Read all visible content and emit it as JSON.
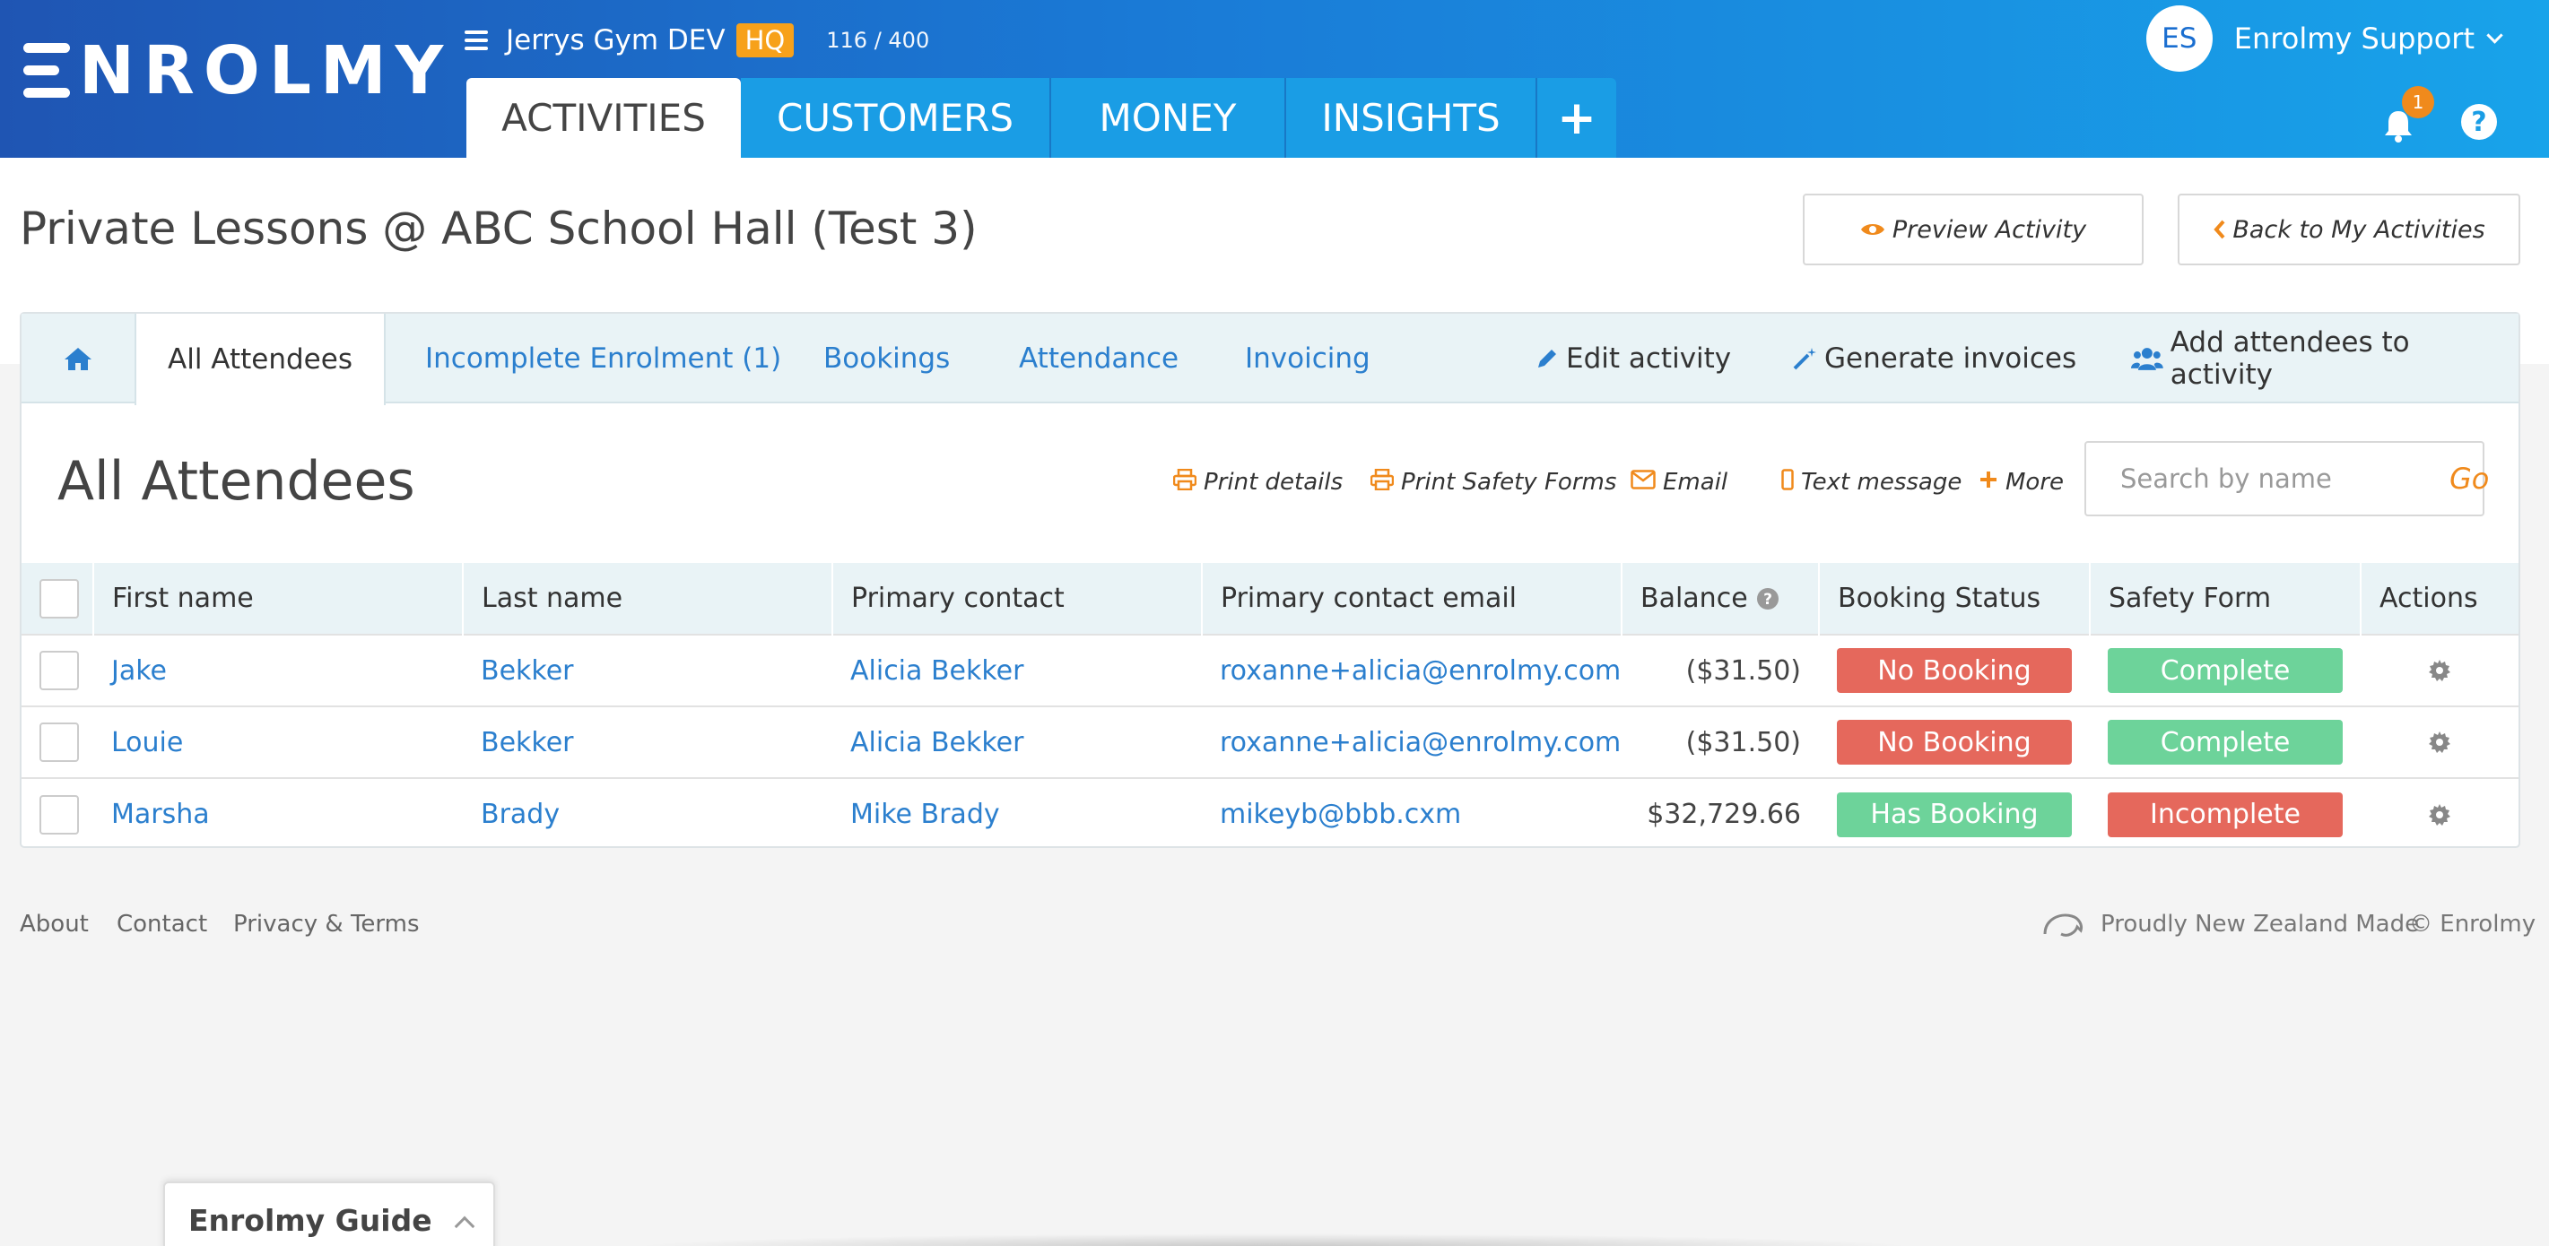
{
  "app": {
    "logo": "ENROLMY",
    "org_name": "Jerrys Gym DEV",
    "org_badge": "HQ",
    "usage": "116 / 400",
    "user_initials": "ES",
    "user_name": "Enrolmy Support",
    "notifications_count": "1",
    "help": "?"
  },
  "nav": {
    "tabs": [
      "ACTIVITIES",
      "CUSTOMERS",
      "MONEY",
      "INSIGHTS"
    ],
    "plus": "+",
    "active": "ACTIVITIES"
  },
  "page": {
    "title": "Private Lessons @ ABC School Hall (Test 3)",
    "preview_button": "Preview Activity",
    "back_button": "Back to My Activities"
  },
  "subnav": {
    "tabs": [
      "All Attendees",
      "Incomplete Enrolment (1)",
      "Bookings",
      "Attendance",
      "Invoicing"
    ],
    "active": "All Attendees",
    "actions": [
      "Edit activity",
      "Generate invoices",
      "Add attendees to activity"
    ]
  },
  "section": {
    "title": "All Attendees",
    "tools": [
      "Print details",
      "Print Safety Forms",
      "Email",
      "Text message",
      "More"
    ],
    "search_placeholder": "Search by name",
    "go": "Go"
  },
  "table": {
    "columns": [
      "First name",
      "Last name",
      "Primary contact",
      "Primary contact email",
      "Balance",
      "Booking Status",
      "Safety Form",
      "Actions"
    ],
    "rows": [
      {
        "first": "Jake",
        "last": "Bekker",
        "contact": "Alicia Bekker",
        "email": "roxanne+alicia@enrolmy.com",
        "balance": "($31.50)",
        "booking": "No Booking",
        "safety": "Complete"
      },
      {
        "first": "Louie",
        "last": "Bekker",
        "contact": "Alicia Bekker",
        "email": "roxanne+alicia@enrolmy.com",
        "balance": "($31.50)",
        "booking": "No Booking",
        "safety": "Complete"
      },
      {
        "first": "Marsha",
        "last": "Brady",
        "contact": "Mike Brady",
        "email": "mikeyb@bbb.cxm",
        "balance": "$32,729.66",
        "booking": "Has Booking",
        "safety": "Incomplete"
      }
    ]
  },
  "footer": {
    "links": [
      "About",
      "Contact",
      "Privacy & Terms"
    ],
    "made": "Proudly New Zealand Made",
    "copyright": "© Enrolmy"
  },
  "guide": {
    "label": "Enrolmy Guide"
  },
  "colors": {
    "header_start": "#1f55b3",
    "header_end": "#18a3ea",
    "link": "#2b7fce",
    "accent_orange": "#f08a1c",
    "status_red": "#e5685c",
    "status_green": "#6dd39a"
  }
}
